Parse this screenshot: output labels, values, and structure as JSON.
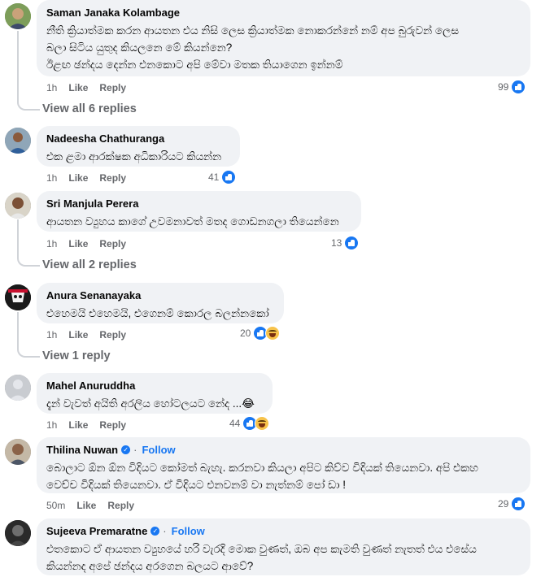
{
  "comments": [
    {
      "author": "Saman Janaka Kolambage",
      "lines": [
        "නීති ක්‍රියාත්මක කරන ආයතන එය නිසි ලෙස ක්‍රියාත්මක නොකරන්නේ නම් අප බුරුවන් ලෙස",
        "බලා සිටිය යුතුද කියලනෙ මේ කියන්නෙ?",
        "ඊළඟ ඡන්දය දෙන්න එනකොට අපි මේවා මතක තියාගෙන ඉන්නම්"
      ],
      "time": "1h",
      "like": "Like",
      "reply": "Reply",
      "reaction_count": "99",
      "reactions": [
        "like-icon"
      ],
      "view_replies": "View all 6 replies"
    },
    {
      "author": "Nadeesha Chathuranga",
      "lines": [
        "එක ළමා ආරක්ෂක අධිකාරියට කියන්න"
      ],
      "time": "1h",
      "like": "Like",
      "reply": "Reply",
      "reaction_count": "41",
      "reactions": [
        "like-icon"
      ]
    },
    {
      "author": "Sri Manjula Perera",
      "lines": [
        "ආයතන ව්‍යුහය කාගේ උවමනාවත් මතද ගොඩනගලා තියෙන්නෙ"
      ],
      "time": "1h",
      "like": "Like",
      "reply": "Reply",
      "reaction_count": "13",
      "reactions": [
        "like-icon"
      ],
      "view_replies": "View all 2 replies"
    },
    {
      "author": "Anura Senanayaka",
      "lines": [
        "එහෙමයි එහෙමයි, එගෙනම් කොරල බලන්නකෝ"
      ],
      "time": "1h",
      "like": "Like",
      "reply": "Reply",
      "reaction_count": "20",
      "reactions": [
        "like-icon",
        "haha-icon"
      ],
      "view_replies": "View 1 reply"
    },
    {
      "author": "Mahel Anuruddha",
      "lines": [
        "දැන් වැවත් අයිති අරලිය හෝටලයට නේද ...😂"
      ],
      "time": "1h",
      "like": "Like",
      "reply": "Reply",
      "reaction_count": "44",
      "reactions": [
        "like-icon",
        "haha-icon"
      ]
    },
    {
      "author": "Thilina Nuwan",
      "verified": "✓",
      "dot": "·",
      "follow": "Follow",
      "lines": [
        "බොලාට ඕන ඕන විදියට කෝමත් බැහැ. කරනවා කියලා අපිට කිව්ව විදියක් තියෙනවා. අපි එකහ",
        "වෙච්ච විදියක් තියෙනවා. ඒ විදියට එනවනම් වා නැත්නම් පෝ ඩා !"
      ],
      "time": "50m",
      "like": "Like",
      "reply": "Reply",
      "reaction_count": "29",
      "reactions": [
        "like-icon"
      ]
    },
    {
      "author": "Sujeeva Premaratne",
      "verified": "✓",
      "dot": "·",
      "follow": "Follow",
      "lines": [
        "එතකොට ඒ ආයතන ව්‍යුහයේ හරි වැරදි මොක වුණත්, ඔබ අප කැමති වුණත් නැතත් එය එසේය",
        "කියන්නද අපේ ඡන්දය අරගෙන බලයට ආවේ?"
      ]
    }
  ]
}
